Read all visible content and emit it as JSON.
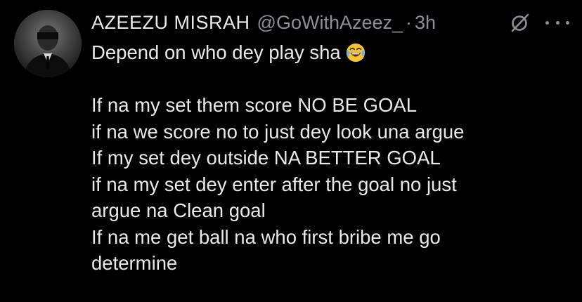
{
  "tweet": {
    "display_name": "AZEEZU MISRAH",
    "handle": "@GoWithAzeez_",
    "separator": "·",
    "time": "3h",
    "first_line": "Depend on who dey play sha",
    "emoji": "laughing-with-tears-emoji",
    "lines": [
      "If na my set them score NO BE GOAL",
      "if na we score no to just dey look una argue",
      "If my set dey outside NA BETTER GOAL",
      "if na my set dey enter after the goal no just",
      "argue na Clean goal",
      "If na me get ball na who first bribe me go",
      "determine"
    ]
  },
  "icons": {
    "avatar": "avatar",
    "grok": "grok-icon",
    "more": "more-icon"
  },
  "colors": {
    "background": "#000000",
    "text": "#e7e9ea",
    "secondary": "#8b9095"
  }
}
